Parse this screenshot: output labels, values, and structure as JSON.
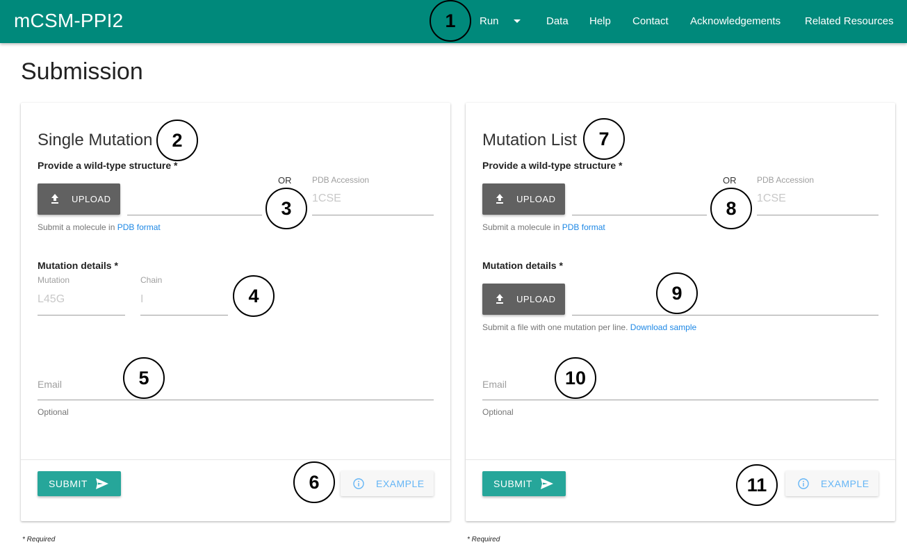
{
  "navbar": {
    "brand": "mCSM-PPI2",
    "items": [
      {
        "label": "Run",
        "has_dropdown": true
      },
      {
        "label": "Data"
      },
      {
        "label": "Help"
      },
      {
        "label": "Contact"
      },
      {
        "label": "Acknowledgements"
      },
      {
        "label": "Related Resources"
      }
    ]
  },
  "page": {
    "title": "Submission"
  },
  "single_mutation": {
    "title": "Single Mutation",
    "structure_label": "Provide a wild-type structure *",
    "upload_label": "UPLOAD",
    "or_text": "OR",
    "pdb_accession_label": "PDB Accession",
    "pdb_accession_placeholder": "1CSE",
    "helper_prefix": "Submit a molecule in ",
    "helper_link": "PDB format",
    "mutation_details_label": "Mutation details *",
    "mutation_label": "Mutation",
    "mutation_placeholder": "L45G",
    "chain_label": "Chain",
    "chain_placeholder": "I",
    "email_label": "Email",
    "email_helper": "Optional",
    "submit_label": "SUBMIT",
    "example_label": "EXAMPLE",
    "required_note": "* Required"
  },
  "mutation_list": {
    "title": "Mutation List",
    "structure_label": "Provide a wild-type structure *",
    "upload_label": "UPLOAD",
    "or_text": "OR",
    "pdb_accession_label": "PDB Accession",
    "pdb_accession_placeholder": "1CSE",
    "helper_prefix": "Submit a molecule in ",
    "helper_link": "PDB format",
    "mutation_details_label": "Mutation details *",
    "mutation_upload_label": "UPLOAD",
    "mutation_helper_prefix": "Submit a file with one mutation per line. ",
    "mutation_helper_link": "Download sample",
    "email_label": "Email",
    "email_helper": "Optional",
    "submit_label": "SUBMIT",
    "example_label": "EXAMPLE",
    "required_note": "* Required"
  },
  "annotations": [
    "1",
    "2",
    "3",
    "4",
    "5",
    "6",
    "7",
    "8",
    "9",
    "10",
    "11"
  ],
  "colors": {
    "navbar": "#00897b",
    "submit": "#26a69a",
    "upload": "#616161",
    "link": "#1e88e5",
    "example_text": "#64b5f6"
  }
}
